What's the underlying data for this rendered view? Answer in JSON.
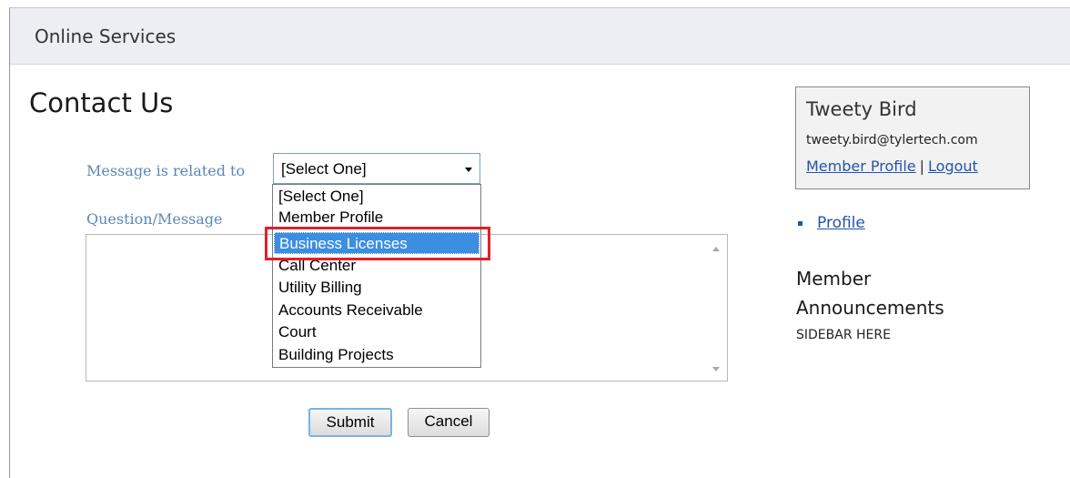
{
  "header": {
    "title": "Online Services"
  },
  "page": {
    "title": "Contact Us"
  },
  "form": {
    "related_label": "Message is related to",
    "message_label": "Question/Message",
    "select_value": "[Select One]",
    "dropdown_options": [
      "[Select One]",
      "Member Profile",
      "Business Licenses",
      "Call Center",
      "Utility Billing",
      "Accounts Receivable",
      "Court",
      "Building Projects"
    ],
    "highlighted_option": "Business Licenses",
    "message_value": "",
    "submit_label": "Submit",
    "cancel_label": "Cancel"
  },
  "user": {
    "name": "Tweety Bird",
    "email": "tweety.bird@tylertech.com",
    "profile_link": "Member Profile",
    "separator": "|",
    "logout_link": "Logout"
  },
  "sidebar": {
    "profile_link": "Profile",
    "announcements_title": "Member Announcements",
    "text": "SIDEBAR HERE"
  },
  "colors": {
    "label_color": "#5b87b8",
    "link_color": "#2255aa",
    "selection_color": "#3b8ee0",
    "highlight_color": "#e0202a"
  }
}
